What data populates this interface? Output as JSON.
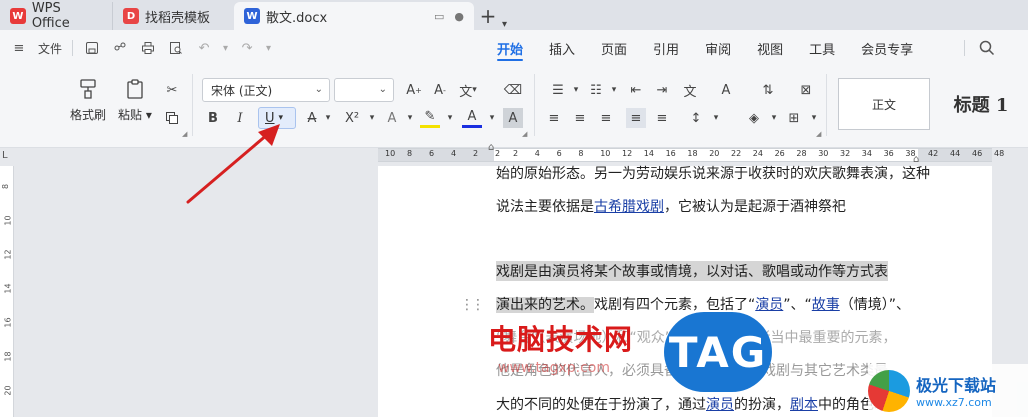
{
  "tabs": [
    {
      "label": "WPS Office",
      "icon": "wps-logo-icon",
      "color": "#e83a3a"
    },
    {
      "label": "找稻壳模板",
      "icon": "docer-logo-icon",
      "color": "#e84545"
    },
    {
      "label": "散文.docx",
      "icon": "word-doc-icon",
      "color": "#2f63d8"
    }
  ],
  "new_tab": "+",
  "menu": {
    "file_label": "文件"
  },
  "ribbon_tabs": [
    "开始",
    "插入",
    "页面",
    "引用",
    "审阅",
    "视图",
    "工具",
    "会员专享"
  ],
  "active_ribbon_tab": "开始",
  "ribbon": {
    "format_painter": "格式刷",
    "paste": "粘贴",
    "font_name": "宋体 (正文)",
    "font_size": "",
    "bold": "B",
    "italic": "I",
    "underline": "U",
    "styles": {
      "normal": "正文",
      "heading1": "标题 1"
    }
  },
  "ruler": {
    "left_numbers": [
      "10",
      "8",
      "6",
      "4",
      "2",
      "2"
    ],
    "main_numbers": [
      "2",
      "4",
      "6",
      "8",
      "10",
      "12",
      "14",
      "16",
      "18",
      "20",
      "22",
      "24",
      "26",
      "28",
      "30",
      "32",
      "34",
      "36",
      "38"
    ],
    "right_numbers": [
      "42",
      "44",
      "46",
      "48"
    ],
    "vertical_numbers": [
      "8",
      "10",
      "12",
      "14",
      "16",
      "18",
      "20"
    ]
  },
  "document": {
    "line1": "始的原始形态。另一为劳动娱乐说来源于收获时的欢庆歌舞表演，这种",
    "line2_a": "说法主要依据是",
    "line2_link": "古希腊戏剧",
    "line2_b": "，它被认为是起源于酒神祭祀",
    "line3": "戏剧是由演员将某个故事或情境，以对话、歌唱或动作等方式表",
    "line4_hl": "演出来的艺术。",
    "line4_a": "戏剧有四个元素，包括了“",
    "line4_link1": "演员",
    "line4_b": "”、“",
    "line4_link2": "故事",
    "line4_c": "（情境）”、",
    "line5": "“舞台”（表演场地）和“观众”。“演员”是四者当中最重要的元素，",
    "line6": "他是角色的代言人，必须具备扮演的能力，戏剧与其它艺术类最",
    "line7_a": "大的不同的处便在于扮演了，通过",
    "line7_link1": "演员",
    "line7_b": "的扮演，",
    "line7_link2": "剧本",
    "line7_c": "中的角色才"
  },
  "watermarks": {
    "site_name": "电脑技术网",
    "site_url": "www.tagxp.com",
    "tag": "TAG",
    "corner_title": "极光下载站",
    "corner_url": "www.xz7.com"
  }
}
